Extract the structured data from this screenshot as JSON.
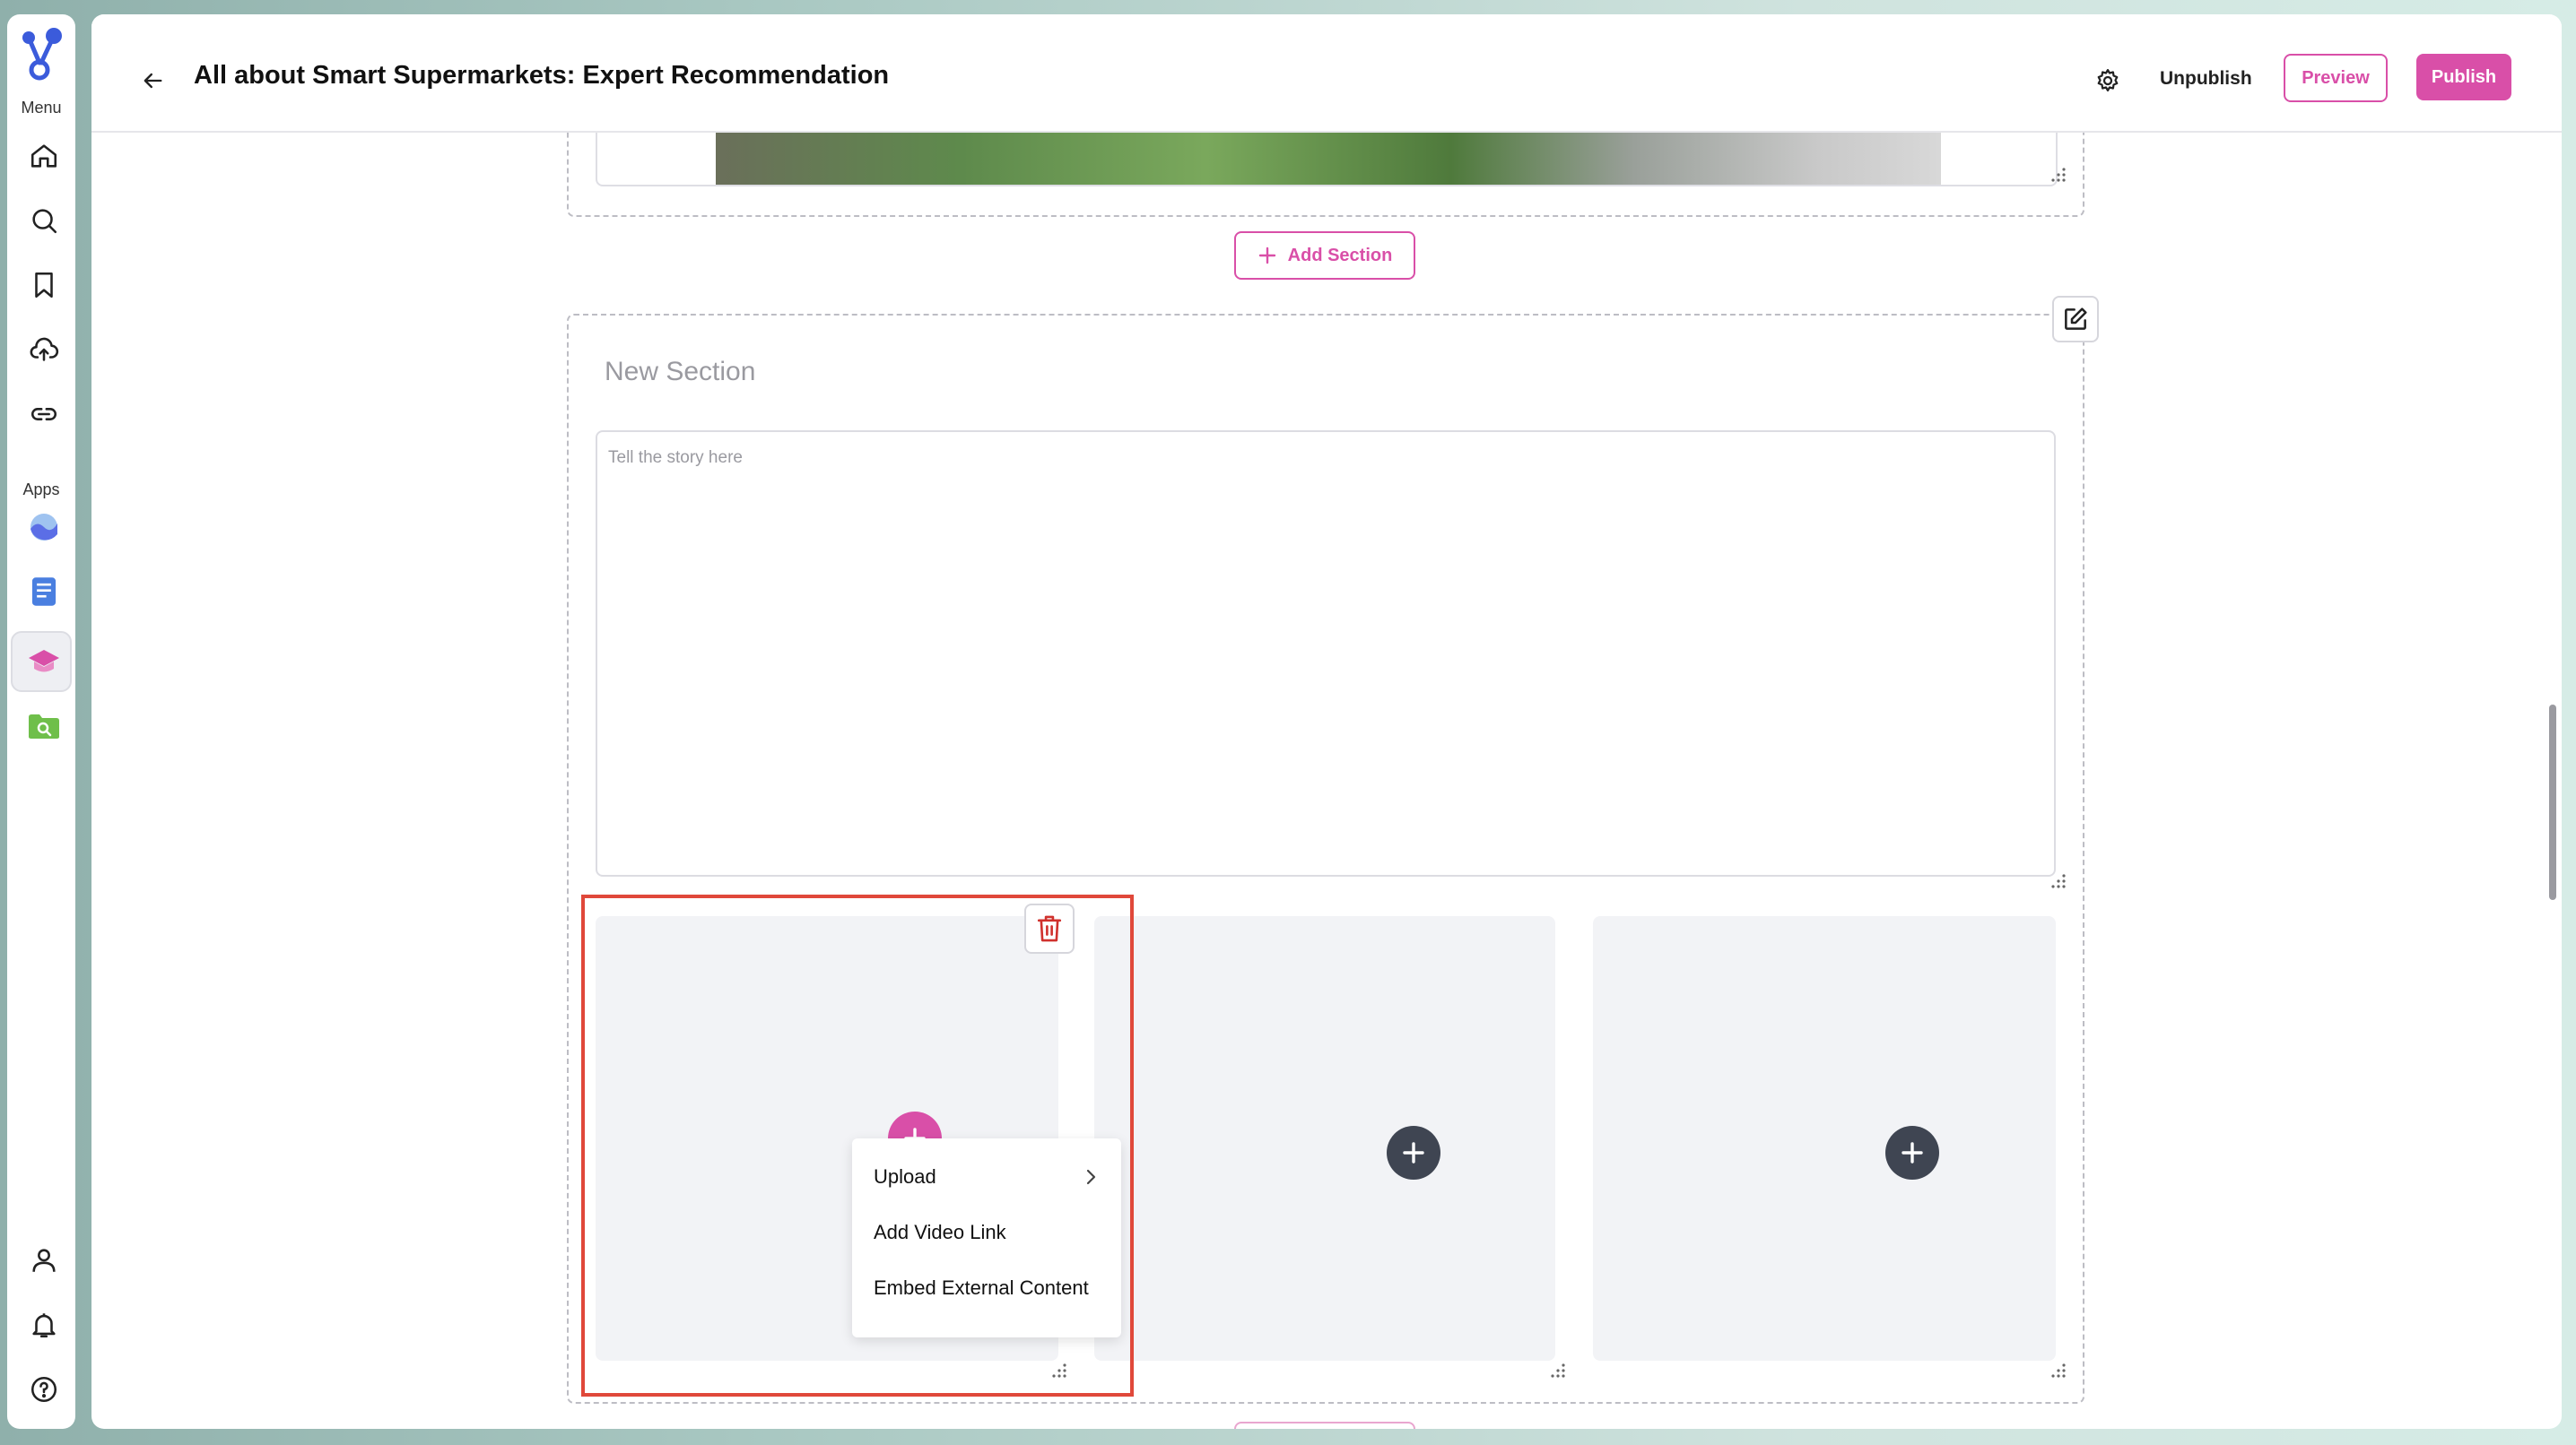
{
  "sidebar": {
    "menu_label": "Menu",
    "apps_label": "Apps",
    "items": [
      {
        "icon": "home-icon"
      },
      {
        "icon": "search-icon"
      },
      {
        "icon": "bookmark-icon"
      },
      {
        "icon": "upload-cloud-icon"
      },
      {
        "icon": "link-icon"
      }
    ],
    "apps": [
      {
        "icon": "wave-app-icon"
      },
      {
        "icon": "document-app-icon"
      },
      {
        "icon": "learning-app-icon",
        "active": true
      },
      {
        "icon": "folder-search-app-icon"
      }
    ],
    "bottom": [
      {
        "icon": "user-icon"
      },
      {
        "icon": "bell-icon"
      },
      {
        "icon": "help-icon"
      }
    ]
  },
  "header": {
    "title": "All about Smart Supermarkets: Expert Recommendation",
    "unpublish_label": "Unpublish",
    "preview_label": "Preview",
    "publish_label": "Publish"
  },
  "editor": {
    "add_section_label": "Add Section",
    "section_title_placeholder": "New Section",
    "story_placeholder": "Tell the story here"
  },
  "media_menu": {
    "items": [
      "Upload",
      "Add Video Link",
      "Embed External Content"
    ]
  },
  "colors": {
    "accent": "#d94fa8",
    "highlight_border": "#e0483a",
    "delete_red": "#d0312d",
    "dark_button": "#3f4552"
  }
}
